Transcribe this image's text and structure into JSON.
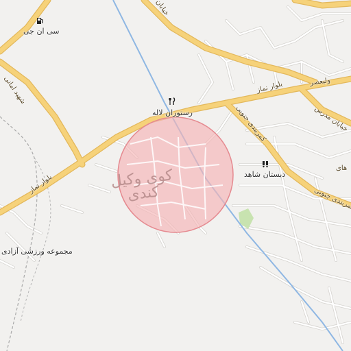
{
  "map": {
    "area": {
      "line1": "کوی وکیل",
      "line2": "کندی",
      "circle_fill": "#f4b3b6",
      "circle_stroke": "#e58a90"
    },
    "pois": {
      "gas_station": "سی ان جی",
      "restaurant": "رستوران لاله",
      "school": "دبستان شاهد",
      "sports": "مجموعه ورزشی آزادی"
    },
    "roads": {
      "blvd_namaz_west": "بلوار نماز",
      "blvd_namaz_east": "بلوار نماز",
      "kamarbandi": "کمربندی جنوبی",
      "kamarbandi_south": "کمربندی جنوبی",
      "shahid_amani": "شهید امانی",
      "khiaban_top": "خیابان",
      "modares": "خیابان مدرس",
      "valiasr": "ولیعصر",
      "haye": "های"
    },
    "colors": {
      "background": "#f2f1ef",
      "major_road": "#f6d27a",
      "major_road_casing": "#e3b85c",
      "minor_road": "#ffffff",
      "minor_road_casing": "#d9d7d3",
      "river": "#8fb7e3",
      "park": "#c8e3b0"
    }
  }
}
